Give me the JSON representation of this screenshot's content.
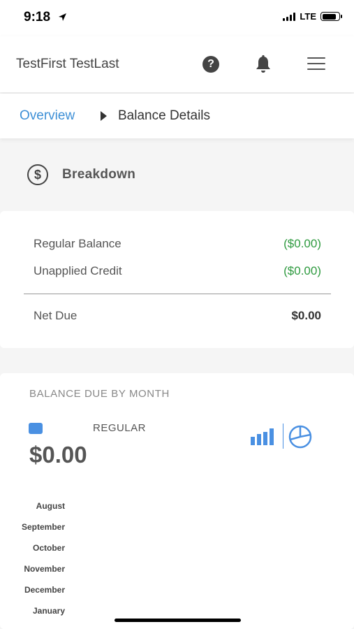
{
  "status_bar": {
    "time": "9:18",
    "network": "LTE",
    "battery_level": 0.85
  },
  "header": {
    "user_name": "TestFirst TestLast",
    "help_icon": "question-circle-icon",
    "notifications_icon": "bell-icon",
    "menu_icon": "hamburger-menu-icon"
  },
  "breadcrumb": {
    "overview": "Overview",
    "current": "Balance Details"
  },
  "breakdown": {
    "title": "Breakdown",
    "icon": "dollar-circle-icon",
    "rows": [
      {
        "label": "Regular Balance",
        "value": "($0.00)"
      },
      {
        "label": "Unapplied Credit",
        "value": "($0.00)"
      }
    ],
    "net_due_label": "Net Due",
    "net_due_value": "$0.00"
  },
  "balance_by_month": {
    "title": "BALANCE DUE BY MONTH",
    "legend_label": "REGULAR",
    "total": "$0.00",
    "months": [
      "August",
      "September",
      "October",
      "November",
      "December",
      "January"
    ]
  },
  "colors": {
    "accent": "#3d8fd6",
    "legend": "#4a90e2",
    "credit_green": "#2e9a3f"
  }
}
